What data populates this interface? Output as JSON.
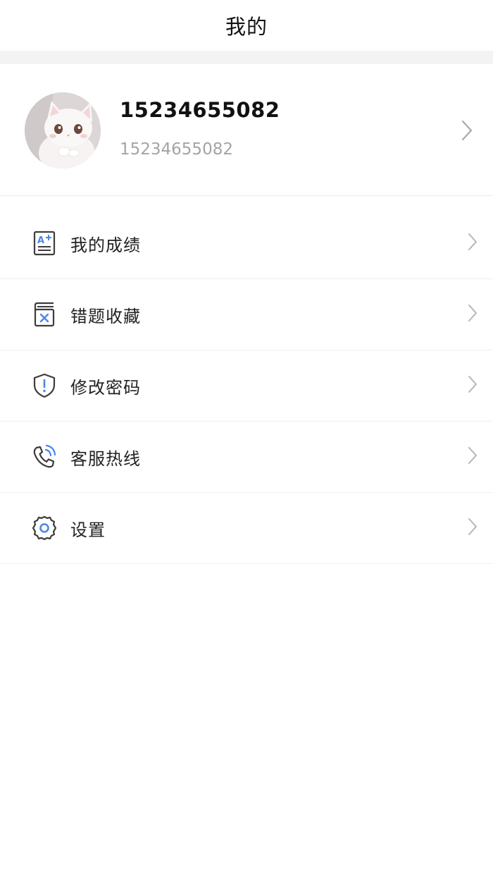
{
  "header": {
    "title": "我的"
  },
  "profile": {
    "name": "15234655082",
    "account": "15234655082",
    "avatar": "white-cat-avatar"
  },
  "menu": {
    "items": [
      {
        "label": "我的成绩",
        "icon": "score-report-icon"
      },
      {
        "label": "错题收藏",
        "icon": "wrong-question-book-icon"
      },
      {
        "label": "修改密码",
        "icon": "shield-alert-icon"
      },
      {
        "label": "客服热线",
        "icon": "phone-call-icon"
      },
      {
        "label": "设置",
        "icon": "gear-icon"
      }
    ]
  },
  "colors": {
    "accent_blue": "#4a86e8",
    "icon_gray": "#3d3d3d",
    "chevron_gray": "#b5b5b5",
    "band_gray": "#f3f3f3"
  }
}
